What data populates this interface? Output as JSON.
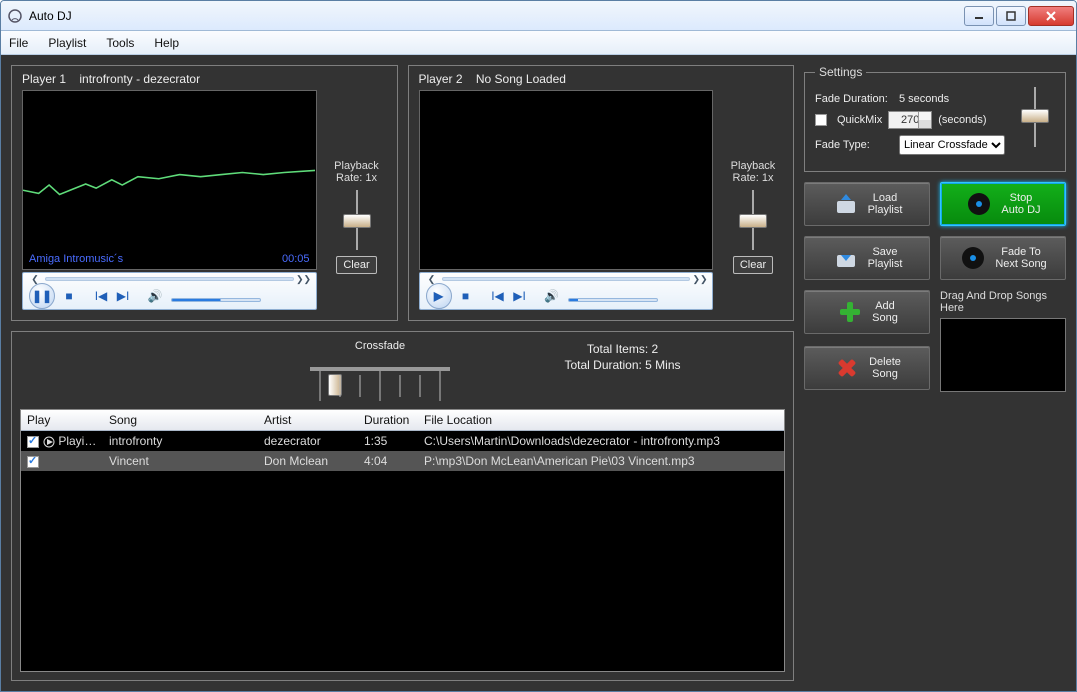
{
  "window": {
    "title": "Auto DJ"
  },
  "menu": {
    "file": "File",
    "playlist": "Playlist",
    "tools": "Tools",
    "help": "Help"
  },
  "players": {
    "p1": {
      "header_label": "Player 1",
      "header_song": "introfronty - dezecrator",
      "now_title": "Amiga Intromusic´s",
      "now_time": "00:05",
      "rate_label": "Playback",
      "rate_value": "Rate: 1x",
      "clear": "Clear"
    },
    "p2": {
      "header_label": "Player 2",
      "header_song": "No Song Loaded",
      "now_title": "",
      "now_time": "",
      "rate_label": "Playback",
      "rate_value": "Rate: 1x",
      "clear": "Clear"
    }
  },
  "crossfade": {
    "label": "Crossfade"
  },
  "totals": {
    "items": "Total Items: 2",
    "duration": "Total Duration: 5 Mins"
  },
  "table": {
    "headers": {
      "play": "Play",
      "song": "Song",
      "artist": "Artist",
      "duration": "Duration",
      "loc": "File Location"
    },
    "rows": [
      {
        "checked": true,
        "play": "Playing",
        "song": "introfronty",
        "artist": "dezecrator",
        "duration": "1:35",
        "loc": "C:\\Users\\Martin\\Downloads\\dezecrator - introfronty.mp3",
        "selected": false
      },
      {
        "checked": true,
        "play": "",
        "song": "Vincent",
        "artist": "Don Mclean",
        "duration": "4:04",
        "loc": "P:\\mp3\\Don McLean\\American Pie\\03 Vincent.mp3",
        "selected": true
      }
    ]
  },
  "settings": {
    "legend": "Settings",
    "fade_dur_label": "Fade Duration:",
    "fade_dur_value": "5 seconds",
    "quickmix_label": "QuickMix",
    "quickmix_value": "270",
    "quickmix_unit": "(seconds)",
    "fade_type_label": "Fade Type:",
    "fade_type_value": "Linear Crossfade"
  },
  "buttons": {
    "load": "Load\nPlaylist",
    "stop": "Stop\nAuto DJ",
    "save": "Save\nPlaylist",
    "fade": "Fade To\nNext Song",
    "add": "Add\nSong",
    "del": "Delete\nSong"
  },
  "drop": {
    "header": "Drag And Drop Songs Here"
  }
}
